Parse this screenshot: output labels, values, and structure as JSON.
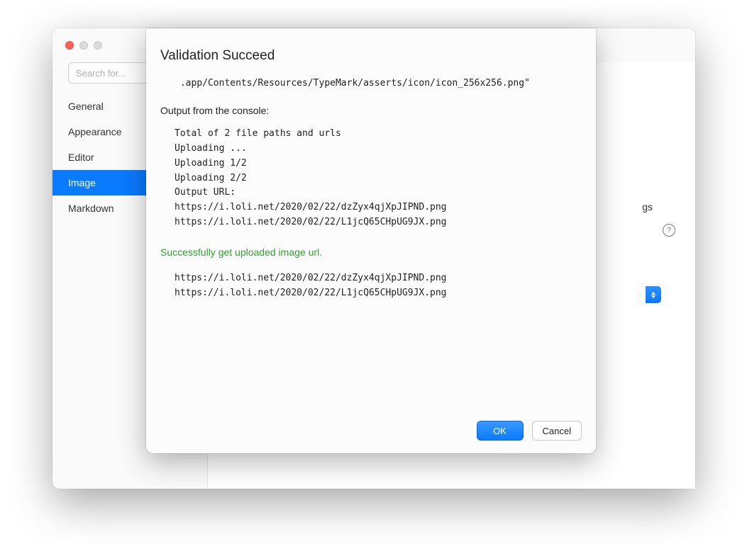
{
  "search": {
    "placeholder": "Search for..."
  },
  "sidebar": {
    "items": [
      {
        "label": "General"
      },
      {
        "label": "Appearance"
      },
      {
        "label": "Editor"
      },
      {
        "label": "Image"
      },
      {
        "label": "Markdown"
      }
    ],
    "active_index": 3
  },
  "background": {
    "partial_text": "gs"
  },
  "modal": {
    "title": "Validation Succeed",
    "path_line": " .app/Contents/Resources/TypeMark/asserts/icon/icon_256x256.png\"",
    "console_label": "Output from the console:",
    "console_lines": [
      "Total of 2 file paths and urls",
      "Uploading ...",
      "Uploading 1/2",
      "Uploading 2/2",
      "Output URL:",
      "https://i.loli.net/2020/02/22/dzZyx4qjXpJIPND.png",
      "https://i.loli.net/2020/02/22/L1jcQ65CHpUG9JX.png"
    ],
    "success_message": "Successfully get uploaded image url.",
    "result_urls": [
      "https://i.loli.net/2020/02/22/dzZyx4qjXpJIPND.png",
      "https://i.loli.net/2020/02/22/L1jcQ65CHpUG9JX.png"
    ],
    "ok_label": "OK",
    "cancel_label": "Cancel"
  }
}
